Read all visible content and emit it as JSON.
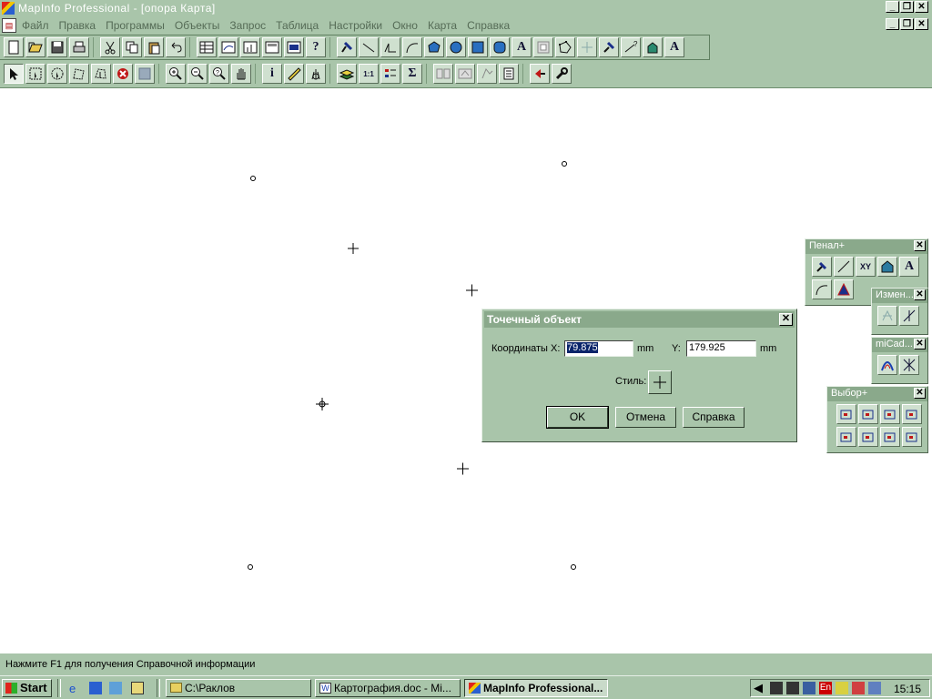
{
  "window": {
    "title": "MapInfo Professional - [опора Карта]"
  },
  "menu": {
    "items": [
      "Файл",
      "Правка",
      "Программы",
      "Объекты",
      "Запрос",
      "Таблица",
      "Настройки",
      "Окно",
      "Карта",
      "Справка"
    ]
  },
  "toolbar_main": [
    "new-icon",
    "open-icon",
    "save-icon",
    "print-icon",
    "cut-icon",
    "copy-icon",
    "paste-icon",
    "undo-icon",
    "browser-icon",
    "map-window-icon",
    "graph-icon",
    "layout-icon",
    "redistrict-icon",
    "help-pointer-icon",
    "symbol-icon",
    "line-icon",
    "polyline-icon",
    "arc-icon",
    "polygon-icon",
    "ellipse-icon",
    "rectangle-icon",
    "rounded-rect-icon",
    "text-icon",
    "frame-icon",
    "reshape-icon",
    "add-node-icon",
    "pushpin-icon",
    "line-style-icon",
    "region-style-icon",
    "text-style-icon"
  ],
  "toolbar_main_text": {
    "help_pointer": "?",
    "text_tool": "A",
    "text_style": "A"
  },
  "toolbar_select": [
    "select-arrow-icon",
    "marquee-select-icon",
    "radius-select-icon",
    "polygon-select-icon",
    "boundary-select-icon",
    "unselect-all-icon",
    "graph-select-icon",
    "zoom-in-icon",
    "zoom-out-icon",
    "change-view-icon",
    "grabber-icon",
    "info-icon",
    "ruler-icon",
    "hotlink-icon",
    "layer-control-icon",
    "label-icon",
    "legend-icon",
    "statistics-icon",
    "drag-map-icon",
    "clip-region-icon",
    "ruler-run-icon",
    "tools-icon",
    "runtime-icon",
    "wrench-icon"
  ],
  "toolbar_select_text": {
    "info": "i",
    "stats": "Σ",
    "label": "1:1"
  },
  "panels": {
    "penal": {
      "title": "Пенал+",
      "icons": [
        "pin-xy-icon",
        "line-xy-icon",
        "xy-icon",
        "house-icon",
        "text-xy-icon",
        "arc-icon",
        "triangle-icon"
      ],
      "xy_text": "XY",
      "text_glyph": "A"
    },
    "izmen": {
      "title": "Измен..."
    },
    "micad": {
      "title": "miCad..."
    },
    "vybor": {
      "title": "Выбор+"
    }
  },
  "dialog": {
    "title": "Точечный объект",
    "coord_label": "Координаты X:",
    "x_value": "79.875",
    "unit_x": "mm",
    "y_label": "Y:",
    "y_value": "179.925",
    "unit_y": "mm",
    "style_label": "Стиль:",
    "ok": "OK",
    "cancel": "Отмена",
    "help": "Справка"
  },
  "status": {
    "text": "Нажмите F1 для получения Справочной информации"
  },
  "taskbar": {
    "start": "Start",
    "tasks": [
      "C:\\Раклов",
      "Картография.doc - Mi...",
      "MapInfo Professional..."
    ],
    "clock": "15:15",
    "lang": "En"
  }
}
